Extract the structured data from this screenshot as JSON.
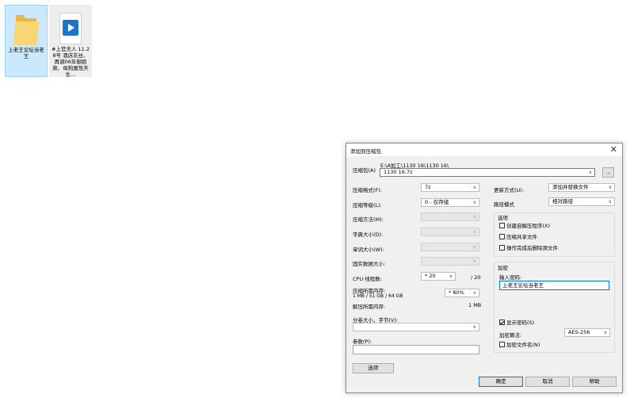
{
  "desktop": {
    "icons": [
      {
        "label": "上老王论坛当老王",
        "icon": "folder-icon"
      },
      {
        "label": "#上官夫人 11.28号 酒店灰丝、再调06年御姐款、母狗属性天生...",
        "icon": "video-file-icon"
      }
    ]
  },
  "dialog": {
    "title": "添加到压缩包",
    "archive": {
      "label": "压缩包(A)",
      "path": "E:\\A加工\\1130 16\\1130 16\\",
      "name": "1130 16.7z",
      "browse": "..."
    },
    "left": {
      "format": {
        "label": "压缩格式(F):",
        "value": "7z"
      },
      "level": {
        "label": "压缩等级(L):",
        "value": "0 - 仅存储"
      },
      "method": {
        "label": "压缩方法(M):"
      },
      "dict": {
        "label": "字典大小(D):"
      },
      "word": {
        "label": "单词大小(W):"
      },
      "solid": {
        "label": "固实数据大小:"
      },
      "cpu": {
        "label": "CPU 线程数:",
        "value": "* 20",
        "max": "/ 20"
      },
      "mem_compress": {
        "label": "压缩所需内存:",
        "detail": "1 MB / 51 GB / 64 GB",
        "value": "* 80%"
      },
      "mem_decompress": {
        "label": "解压所需内存:",
        "value": "1 MB"
      },
      "split": {
        "label": "分卷大小，字节(V):"
      },
      "params": {
        "label": "参数(P):"
      },
      "options_button": "选项"
    },
    "right": {
      "update": {
        "label": "更新方式(U):",
        "value": "添加并替换文件"
      },
      "pathmode": {
        "label": "路径模式",
        "value": "相对路径"
      },
      "options": {
        "title": "选项",
        "sfx": "创建自解压程序(X)",
        "shared": "压缩共享文件",
        "delete": "操作完成后删除源文件"
      },
      "encryption": {
        "title": "加密",
        "password_label": "输入密码:",
        "password": "上老王论坛当老王",
        "show_password": "显示密码(S)",
        "method_label": "加密算法:",
        "method": "AES-256",
        "encrypt_names": "加密文件名(N)"
      }
    },
    "buttons": {
      "ok": "确定",
      "cancel": "取消",
      "help": "帮助"
    }
  }
}
